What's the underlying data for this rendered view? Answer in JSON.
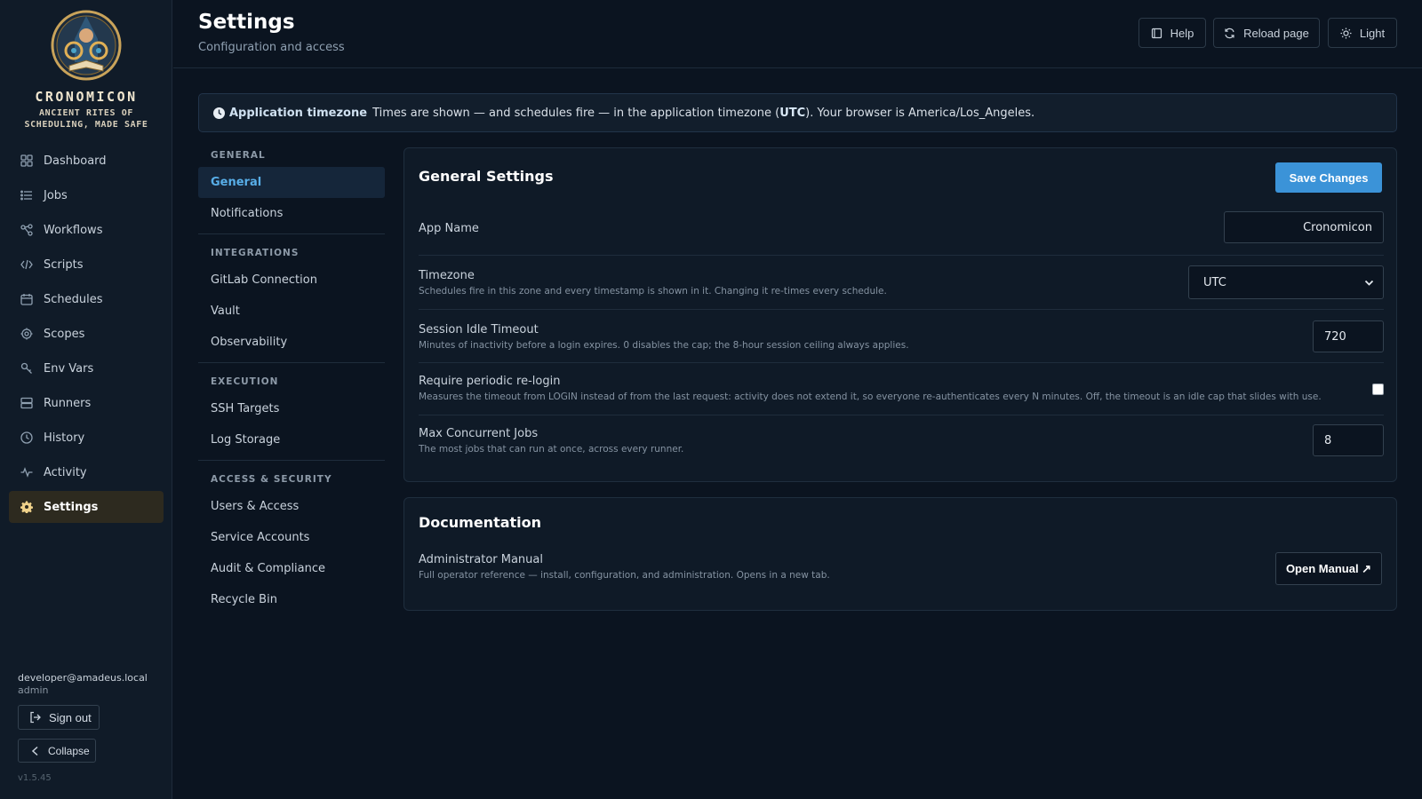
{
  "brand": {
    "name": "CRONOMICON",
    "tagline_line1": "ANCIENT RITES OF",
    "tagline_line2": "SCHEDULING, MADE SAFE"
  },
  "nav": {
    "items": [
      {
        "label": "Dashboard",
        "icon": "grid-icon"
      },
      {
        "label": "Jobs",
        "icon": "list-icon"
      },
      {
        "label": "Workflows",
        "icon": "workflow-icon"
      },
      {
        "label": "Scripts",
        "icon": "code-icon"
      },
      {
        "label": "Schedules",
        "icon": "calendar-icon"
      },
      {
        "label": "Scopes",
        "icon": "target-icon"
      },
      {
        "label": "Env Vars",
        "icon": "key-icon"
      },
      {
        "label": "Runners",
        "icon": "server-icon"
      },
      {
        "label": "History",
        "icon": "clock-icon"
      },
      {
        "label": "Activity",
        "icon": "activity-icon"
      },
      {
        "label": "Settings",
        "icon": "gear-icon",
        "active": true
      }
    ]
  },
  "user": {
    "email": "developer@amadeus.local",
    "role": "admin",
    "sign_out_label": "Sign out",
    "collapse_label": "Collapse",
    "version": "v1.5.45"
  },
  "header": {
    "title": "Settings",
    "subtitle": "Configuration and access",
    "help_label": "Help",
    "reload_label": "Reload page",
    "theme_label": "Light"
  },
  "banner": {
    "label": "Application timezone",
    "text_before": "Times are shown — and schedules fire — in the application timezone (",
    "timezone": "UTC",
    "text_after": "). Your browser is America/Los_Angeles."
  },
  "subnav": {
    "sections": [
      {
        "heading": "GENERAL",
        "items": [
          "General",
          "Notifications"
        ]
      },
      {
        "heading": "INTEGRATIONS",
        "items": [
          "GitLab Connection",
          "Vault",
          "Observability"
        ]
      },
      {
        "heading": "EXECUTION",
        "items": [
          "SSH Targets",
          "Log Storage"
        ]
      },
      {
        "heading": "ACCESS & SECURITY",
        "items": [
          "Users & Access",
          "Service Accounts",
          "Audit & Compliance",
          "Recycle Bin"
        ]
      }
    ],
    "active": "General"
  },
  "general": {
    "title": "General Settings",
    "save_label": "Save Changes",
    "app_name": {
      "label": "App Name",
      "value": "Cronomicon"
    },
    "timezone": {
      "label": "Timezone",
      "desc": "Schedules fire in this zone and every timestamp is shown in it. Changing it re-times every schedule.",
      "value": "UTC"
    },
    "session_idle": {
      "label": "Session Idle Timeout",
      "desc": "Minutes of inactivity before a login expires. 0 disables the cap; the 8-hour session ceiling always applies.",
      "value": "720"
    },
    "relogin": {
      "label": "Require periodic re-login",
      "desc": "Measures the timeout from LOGIN instead of from the last request: activity does not extend it, so everyone re-authenticates every N minutes. Off, the timeout is an idle cap that slides with use.",
      "checked": false
    },
    "max_jobs": {
      "label": "Max Concurrent Jobs",
      "desc": "The most jobs that can run at once, across every runner.",
      "value": "8"
    }
  },
  "docs": {
    "title": "Documentation",
    "manual_label": "Administrator Manual",
    "manual_desc": "Full operator reference — install, configuration, and administration. Opens in a new tab.",
    "open_label": "Open Manual ↗"
  },
  "colors": {
    "accent": "#3b93d8",
    "active_nav_bg": "#2d2a1f",
    "active_subnav_text": "#58aee8"
  }
}
